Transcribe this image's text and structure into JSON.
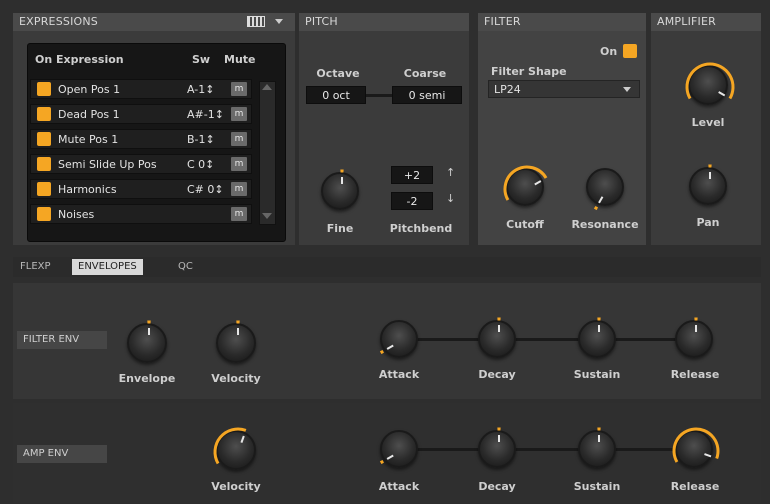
{
  "expressions": {
    "title": "EXPRESSIONS",
    "header_cols": {
      "on_expression": "On Expression",
      "sw": "Sw",
      "mute": "Mute"
    },
    "rows": [
      {
        "name": "Open Pos 1",
        "sw": "A-1↕",
        "mute": "m"
      },
      {
        "name": "Dead Pos 1",
        "sw": "A#-1↕",
        "mute": "m"
      },
      {
        "name": "Mute Pos 1",
        "sw": "B-1↕",
        "mute": "m"
      },
      {
        "name": "Semi Slide Up Pos",
        "sw": "C 0↕",
        "mute": "m"
      },
      {
        "name": "Harmonics",
        "sw": "C# 0↕",
        "mute": "m"
      },
      {
        "name": "Noises",
        "sw": "",
        "mute": "m"
      }
    ]
  },
  "pitch": {
    "title": "PITCH",
    "octave_label": "Octave",
    "octave_value": "0 oct",
    "coarse_label": "Coarse",
    "coarse_value": "0 semi",
    "fine_label": "Fine",
    "pitchbend_label": "Pitchbend",
    "pitchbend_up": "+2",
    "pitchbend_down": "-2"
  },
  "filter": {
    "title": "FILTER",
    "on_label": "On",
    "shape_label": "Filter Shape",
    "shape_value": "LP24",
    "cutoff_label": "Cutoff",
    "resonance_label": "Resonance"
  },
  "amplifier": {
    "title": "AMPLIFIER",
    "level_label": "Level",
    "pan_label": "Pan"
  },
  "tabs": [
    "FLEXP",
    "ENVELOPES",
    "QC"
  ],
  "filter_env": {
    "label": "FILTER ENV",
    "envelope_label": "Envelope",
    "velocity_label": "Velocity",
    "attack_label": "Attack",
    "decay_label": "Decay",
    "sustain_label": "Sustain",
    "release_label": "Release"
  },
  "amp_env": {
    "label": "AMP ENV",
    "velocity_label": "Velocity",
    "attack_label": "Attack",
    "decay_label": "Decay",
    "sustain_label": "Sustain",
    "release_label": "Release"
  },
  "colors": {
    "accent": "#f5a623",
    "panel": "#3b3b3b",
    "background": "#2e2e2e"
  }
}
